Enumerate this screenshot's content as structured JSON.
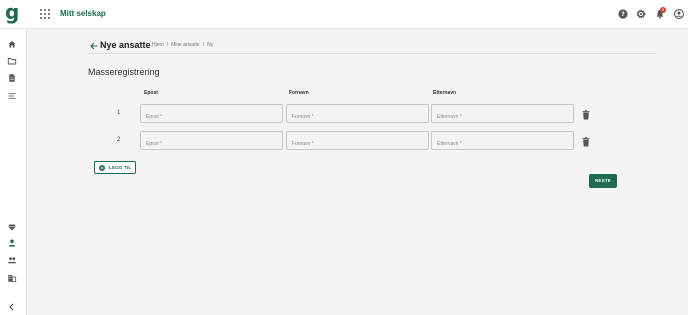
{
  "app": {
    "logo_letter": "g",
    "company": "Mitt selskap",
    "notification_count": "2"
  },
  "icons": {
    "top": [
      "apps-icon",
      "help-icon",
      "gear-icon",
      "bell-icon",
      "account-icon"
    ],
    "sidebar": [
      "home-icon",
      "folder-icon",
      "document-icon",
      "list-icon",
      "diamond-icon",
      "person-icon",
      "group-icon",
      "building-icon",
      "collapse-icon"
    ]
  },
  "colors": {
    "brand": "#1e6b50",
    "badge": "#d23b3b"
  },
  "page": {
    "title": "Nye ansatte",
    "breadcrumb": [
      "Hjem",
      "Mine ansatte",
      "Ny"
    ],
    "breadcrumb_separator": "/",
    "section_title": "Masseregistrering"
  },
  "table": {
    "columns": [
      "Epost",
      "Fornavn",
      "Etternavn"
    ],
    "rows": [
      {
        "num": "1",
        "email": "",
        "first": "",
        "last": ""
      },
      {
        "num": "2",
        "email": "",
        "first": "",
        "last": ""
      }
    ],
    "placeholders": {
      "email": "Epost *",
      "first": "Fornavn *",
      "last": "Etternavn *"
    }
  },
  "actions": {
    "add_label": "LEGG TIL",
    "next_label": "NESTE"
  }
}
